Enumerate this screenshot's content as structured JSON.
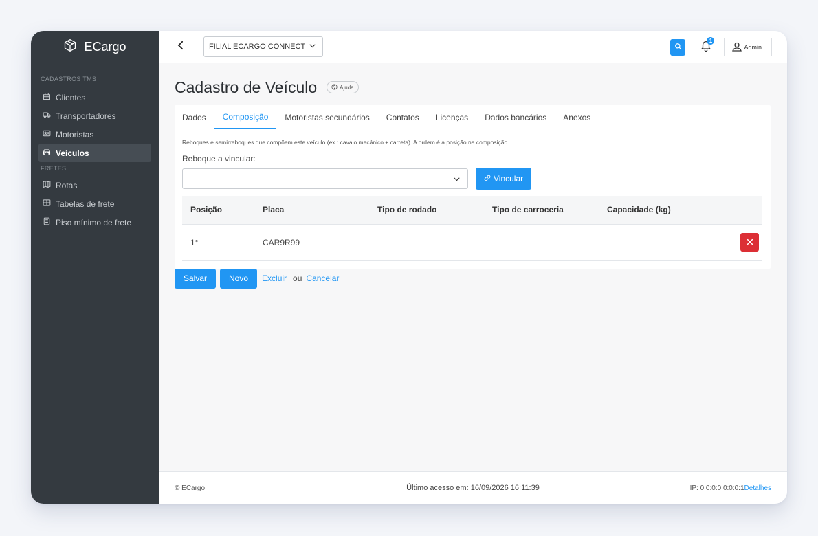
{
  "brand": {
    "name": "ECargo"
  },
  "sidebar": {
    "sections": [
      {
        "title": "CADASTROS TMS",
        "items": [
          {
            "label": "Clientes",
            "icon": "building-icon"
          },
          {
            "label": "Transportadores",
            "icon": "truck-icon"
          },
          {
            "label": "Motoristas",
            "icon": "id-card-icon"
          },
          {
            "label": "Veículos",
            "icon": "car-icon",
            "active": true
          }
        ]
      },
      {
        "title": "FRETES",
        "items": [
          {
            "label": "Rotas",
            "icon": "map-icon"
          },
          {
            "label": "Tabelas de frete",
            "icon": "table-icon"
          },
          {
            "label": "Piso mínimo de frete",
            "icon": "document-icon"
          }
        ]
      }
    ]
  },
  "topbar": {
    "branch": "FILIAL ECARGO CONNECT",
    "notification_count": "1",
    "user": "Admin"
  },
  "page": {
    "title": "Cadastro de Veículo",
    "help": "Ajuda"
  },
  "tabs": [
    {
      "label": "Dados"
    },
    {
      "label": "Composição",
      "active": true
    },
    {
      "label": "Motoristas secundários"
    },
    {
      "label": "Contatos"
    },
    {
      "label": "Licenças"
    },
    {
      "label": "Dados bancários"
    },
    {
      "label": "Anexos"
    }
  ],
  "composition": {
    "hint": "Reboques e semirreboques que compõem este veículo (ex.: cavalo mecânico + carreta). A ordem é a posição na composição.",
    "field_label": "Reboque a vincular:",
    "select_value": "",
    "link_button": "Vincular",
    "columns": [
      "Posição",
      "Placa",
      "Tipo de rodado",
      "Tipo de carroceria",
      "Capacidade (kg)"
    ],
    "rows": [
      {
        "posicao": "1°",
        "placa": "CAR9R99",
        "rodado": "",
        "carroceria": "",
        "capacidade": ""
      }
    ]
  },
  "actions": {
    "save": "Salvar",
    "new": "Novo",
    "delete": "Excluir",
    "or": "ou",
    "cancel": "Cancelar"
  },
  "footer": {
    "copyright": "© ECargo",
    "last_access": "Último acesso em: 16/09/2026 16:11:39",
    "ip": "IP: 0:0:0:0:0:0:0:1",
    "details": "Detalhes"
  },
  "colors": {
    "primary": "#2196f3",
    "danger": "#dc2f35",
    "sidebar": "#343a40"
  }
}
